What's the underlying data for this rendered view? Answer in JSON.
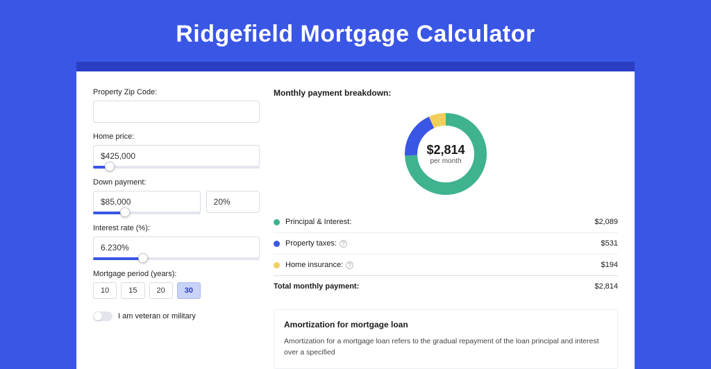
{
  "title": "Ridgefield Mortgage Calculator",
  "form": {
    "zip_label": "Property Zip Code:",
    "zip_value": "",
    "price_label": "Home price:",
    "price_value": "$425,000",
    "price_slider_pct": 10,
    "down_label": "Down payment:",
    "down_value": "$85,000",
    "down_pct_value": "20%",
    "down_slider_pct": 20,
    "rate_label": "Interest rate (%):",
    "rate_value": "6.230%",
    "rate_slider_pct": 30,
    "period_label": "Mortgage period (years):",
    "periods": [
      "10",
      "15",
      "20",
      "30"
    ],
    "period_selected": "30",
    "vet_label": "I am veteran or military"
  },
  "breakdown": {
    "title": "Monthly payment breakdown:",
    "donut_amount": "$2,814",
    "donut_sub": "per month",
    "items": [
      {
        "label": "Principal & Interest:",
        "value": "$2,089",
        "color": "#3fb28f",
        "has_help": false
      },
      {
        "label": "Property taxes:",
        "value": "$531",
        "color": "#3a56e4",
        "has_help": true
      },
      {
        "label": "Home insurance:",
        "value": "$194",
        "color": "#f2cf5b",
        "has_help": true
      }
    ],
    "total_label": "Total monthly payment:",
    "total_value": "$2,814"
  },
  "amort": {
    "title": "Amortization for mortgage loan",
    "text": "Amortization for a mortgage loan refers to the gradual repayment of the loan principal and interest over a specified"
  },
  "chart_data": {
    "type": "pie",
    "title": "Monthly payment breakdown",
    "series": [
      {
        "name": "Principal & Interest",
        "value": 2089,
        "color": "#3fb28f"
      },
      {
        "name": "Property taxes",
        "value": 531,
        "color": "#3a56e4"
      },
      {
        "name": "Home insurance",
        "value": 194,
        "color": "#f2cf5b"
      }
    ],
    "total": 2814,
    "center_label": "$2,814 per month"
  }
}
